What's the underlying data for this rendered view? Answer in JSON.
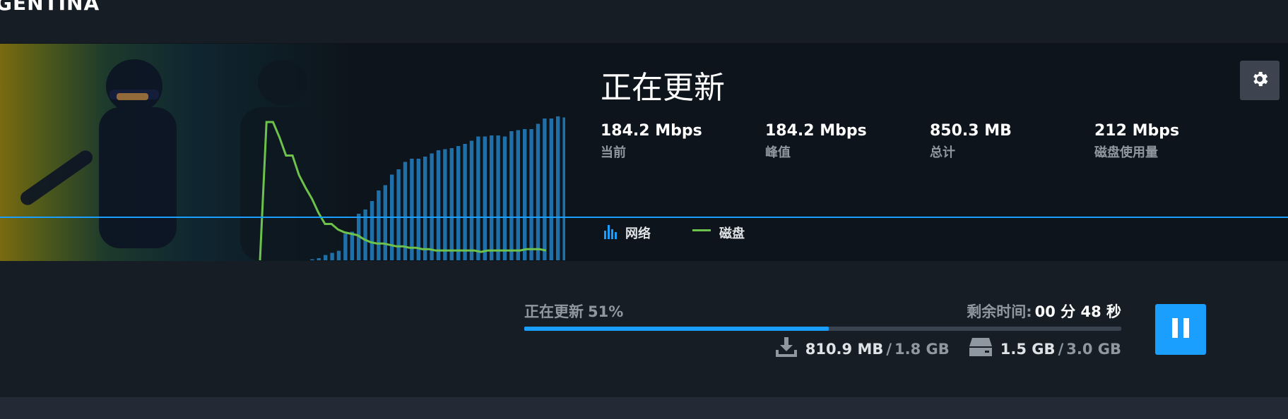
{
  "game": {
    "title": "GENTINA"
  },
  "status": {
    "title": "正在更新"
  },
  "stats": [
    {
      "value": "184.2 Mbps",
      "label": "当前"
    },
    {
      "value": "184.2 Mbps",
      "label": "峰值"
    },
    {
      "value": "850.3 MB",
      "label": "总计"
    },
    {
      "value": "212 Mbps",
      "label": "磁盘使用量"
    }
  ],
  "legend": {
    "network": "网络",
    "disk": "磁盘"
  },
  "colors": {
    "accent": "#1a9fff",
    "network_bar": "#1f6fa8",
    "disk_line": "#6cc24a"
  },
  "chart_data": {
    "type": "bar",
    "series": [
      {
        "name": "网络",
        "values": [
          0,
          0,
          0,
          0,
          0,
          0,
          0,
          0,
          1,
          2,
          5,
          7,
          9,
          25,
          27,
          44,
          48,
          56,
          66,
          71,
          81,
          86,
          93,
          96,
          96,
          98,
          101,
          104,
          105,
          106,
          108,
          110,
          113,
          117,
          117,
          118,
          118,
          117,
          122,
          123,
          124,
          124,
          129,
          134,
          134,
          136,
          135
        ]
      },
      {
        "name": "磁盘",
        "values": [
          0,
          99,
          99,
          88,
          75,
          75,
          61,
          52,
          44,
          34,
          26,
          26,
          22,
          20,
          19,
          18,
          15,
          13,
          12,
          12,
          11,
          10,
          10,
          9,
          9,
          8,
          8,
          7,
          7,
          7,
          7,
          7,
          7,
          7,
          6,
          7,
          7,
          7,
          7,
          7,
          7,
          8,
          8,
          8,
          7
        ]
      }
    ]
  },
  "progress": {
    "label": "正在更新",
    "percent_text": "51%",
    "fraction": 0.51,
    "remaining_label": "剩余时间:",
    "remaining_value": "00 分 48 秒",
    "downloaded": "810.9 MB",
    "download_total": "1.8 GB",
    "disk_written": "1.5 GB",
    "disk_total": "3.0 GB",
    "separator": "/"
  },
  "icons": {
    "settings": "gear-icon",
    "pause": "pause-icon",
    "download": "download-icon",
    "disk": "disk-icon",
    "network_legend": "network-bars-icon",
    "disk_legend": "disk-line-icon"
  }
}
